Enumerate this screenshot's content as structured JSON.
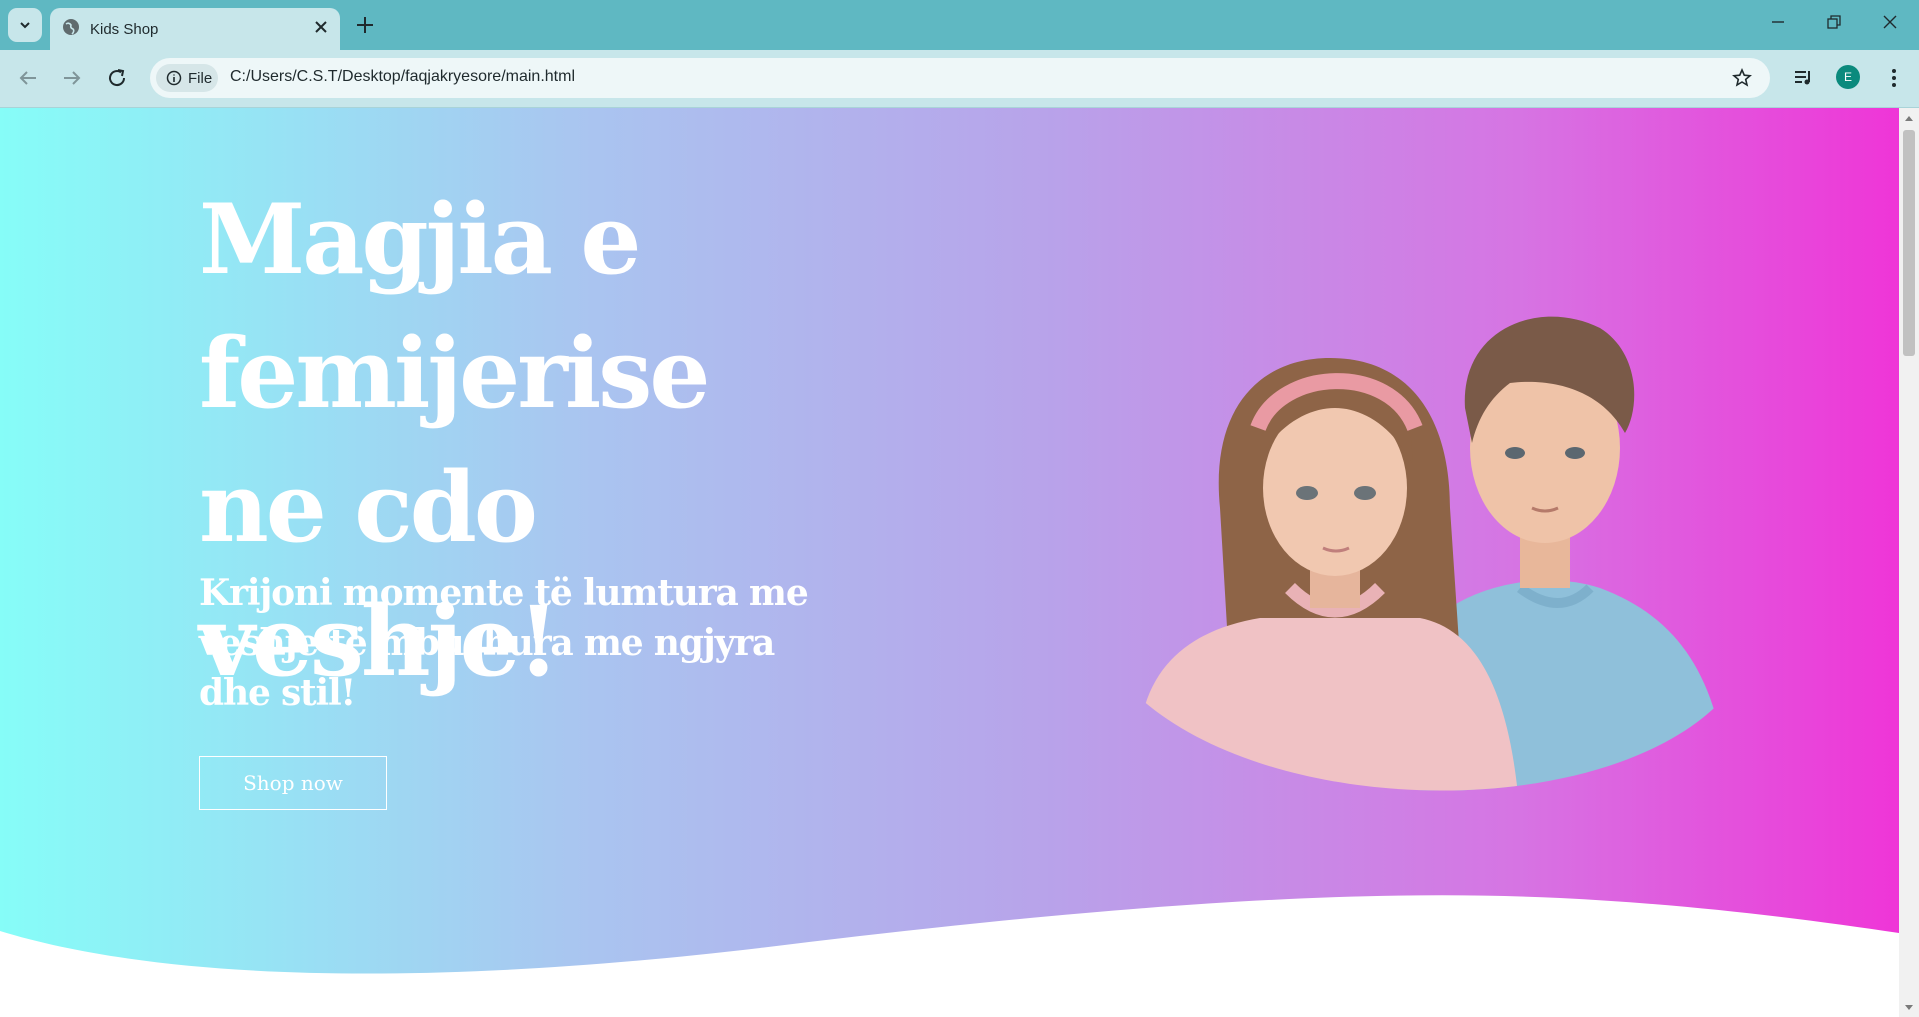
{
  "browser": {
    "tab_title": "Kids Shop",
    "url_chip": "File",
    "url": "C:/Users/C.S.T/Desktop/faqjakryesore/main.html",
    "profile_initial": "E"
  },
  "hero": {
    "headline": "Magjia e femijerise ne cdo veshje!",
    "subheadline": "Krijoni momente të lumtura me veshje të mbushura me ngjyra dhe stil!",
    "cta_label": "Shop now",
    "image_subject": "girl and boy children portrait",
    "gradient_colors": [
      "#86fdf8",
      "#b8a3ea",
      "#ef35d7"
    ]
  }
}
